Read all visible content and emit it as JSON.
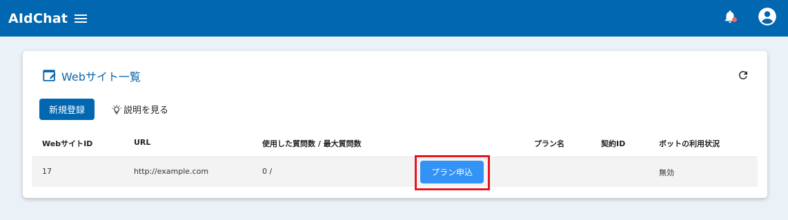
{
  "header": {
    "brand": "AIdChat",
    "menu_icon": "hamburger-menu-icon",
    "bell_icon": "bell-icon",
    "avatar_icon": "account-circle-icon",
    "colors": {
      "bar": "#0067b0",
      "notification_dot": "#ef6b5b"
    }
  },
  "card": {
    "title": "Webサイト一覧",
    "title_icon": "edit-window-icon",
    "refresh_icon": "refresh-icon",
    "register_button": "新規登録",
    "help_link": "説明を見る",
    "help_icon": "lightbulb-icon"
  },
  "table": {
    "columns": [
      "WebサイトID",
      "URL",
      "使用した質問数 / 最大質問数",
      "プラン名",
      "契約ID",
      "ボットの利用状況"
    ],
    "rows": [
      {
        "site_id": "17",
        "url": "http://example.com",
        "usage": "0 /",
        "action": "プラン申込",
        "plan_name": "",
        "contract_id": "",
        "bot_status": "無効"
      }
    ]
  },
  "colors": {
    "primary": "#0067b0",
    "apply_button": "#3392f5",
    "highlight": "#e8141b"
  }
}
